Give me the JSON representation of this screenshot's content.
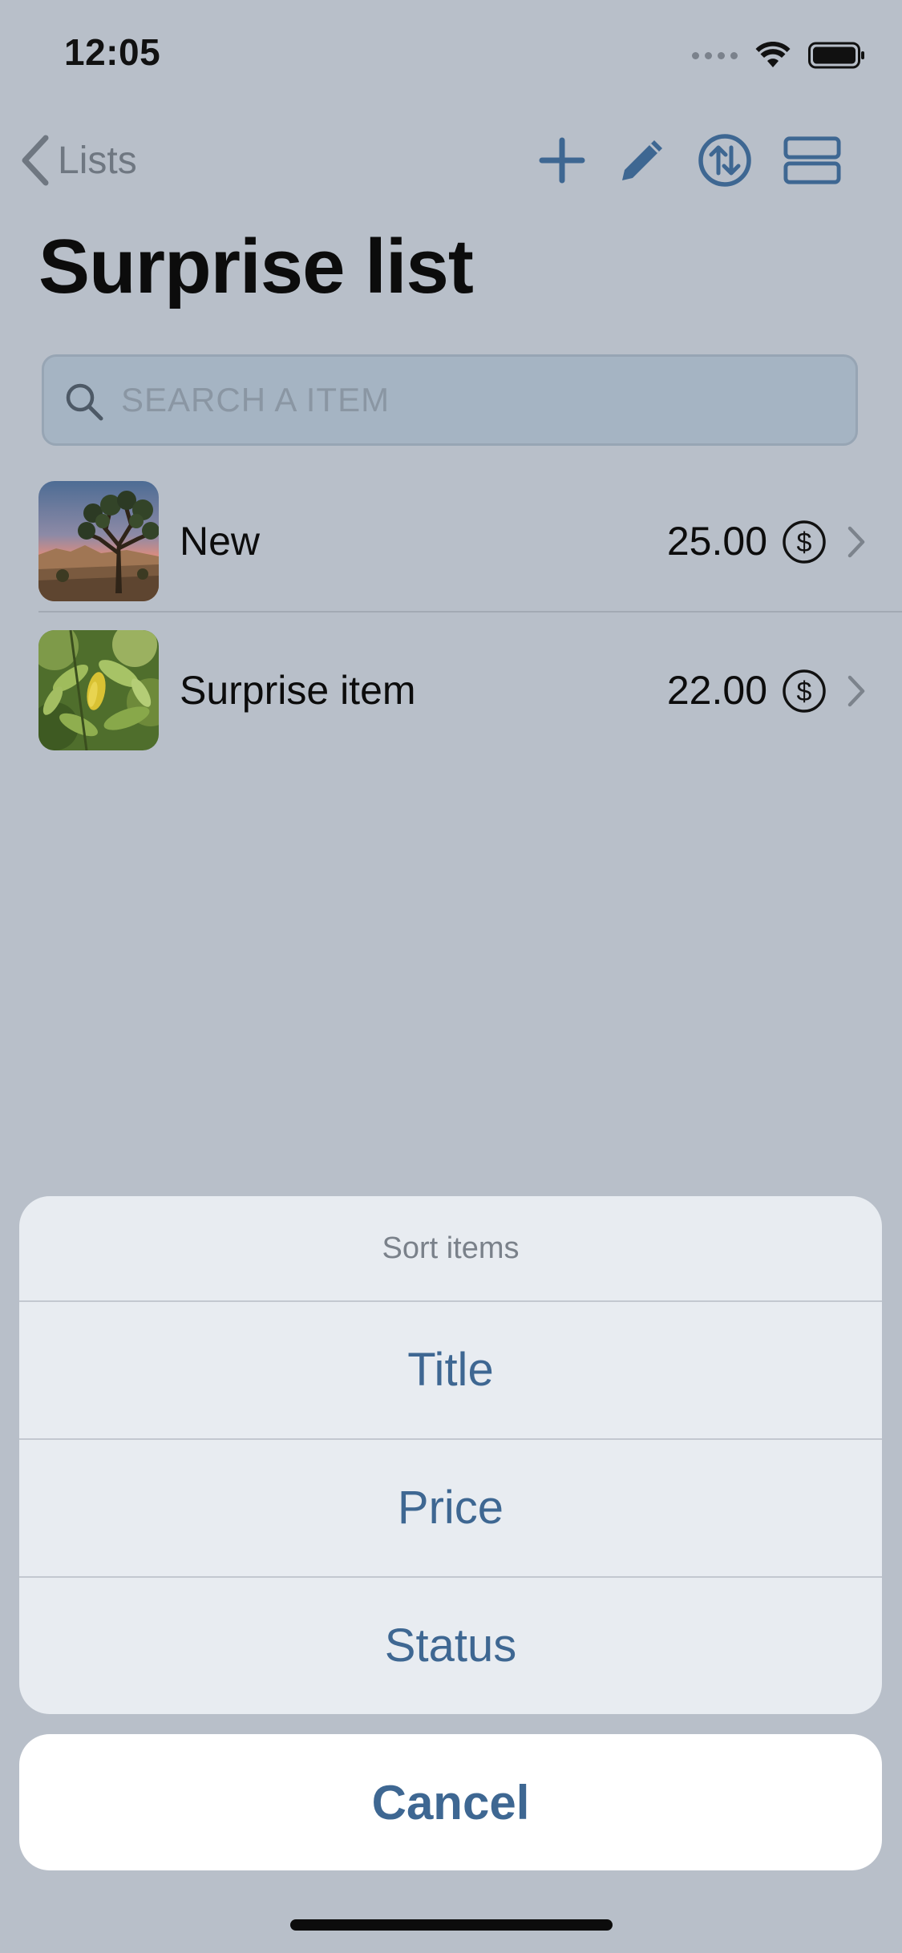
{
  "status_bar": {
    "time": "12:05"
  },
  "nav": {
    "back_label": "Lists",
    "icons": [
      "plus-icon",
      "pencil-icon",
      "sort-icon",
      "layout-icon"
    ],
    "accent_color": "#3e6792"
  },
  "page": {
    "title": "Surprise list"
  },
  "search": {
    "placeholder": "SEARCH A ITEM",
    "value": ""
  },
  "items": [
    {
      "title": "New",
      "price": "25.00",
      "currency_icon": "dollar-circle-icon",
      "thumbnail": "desert-tree-photo"
    },
    {
      "title": "Surprise item",
      "price": "22.00",
      "currency_icon": "dollar-circle-icon",
      "thumbnail": "green-leaves-photo"
    }
  ],
  "action_sheet": {
    "title": "Sort items",
    "options": [
      "Title",
      "Price",
      "Status"
    ],
    "cancel_label": "Cancel"
  }
}
